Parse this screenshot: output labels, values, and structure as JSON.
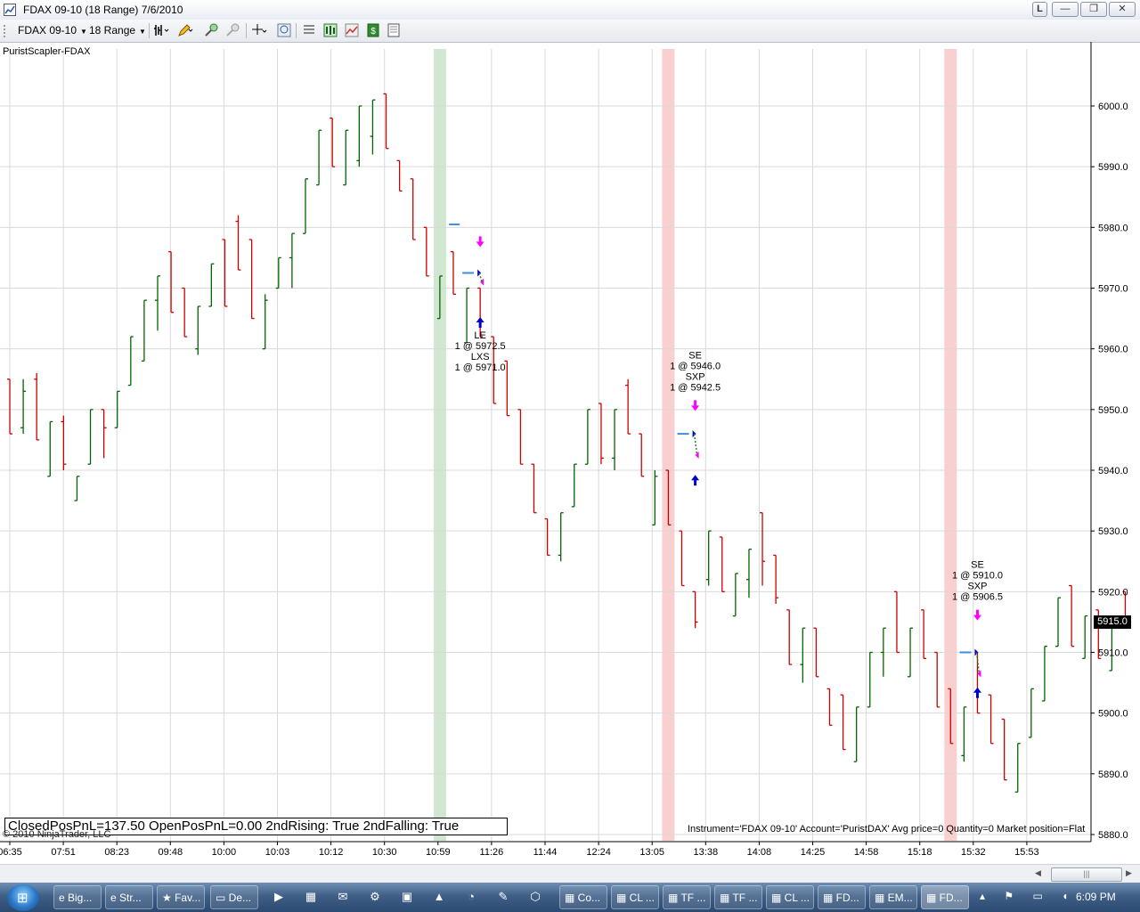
{
  "window": {
    "title": "FDAX 09-10 (18 Range)  7/6/2010",
    "buttons": {
      "link": "L",
      "minimize": "—",
      "maximize": "❐",
      "close": "✕"
    }
  },
  "toolbar": {
    "instrument": "FDAX 09-10",
    "period": "18 Range",
    "icons": [
      "bar-type-icon",
      "drawing-pencil-icon",
      "zoom-in-icon",
      "zoom-out-icon",
      "crosshair-icon",
      "magnify-icon",
      "properties-icon",
      "strategies-icon",
      "indicators-icon",
      "dollar-icon",
      "data-box-icon"
    ]
  },
  "chart": {
    "indicator_label": "PuristScapler-FDAX",
    "pnl_text": "ClosedPosPnL=137.50 OpenPosPnL=0.00 2ndRising: True 2ndFalling: True",
    "copyright": "© 2010 NinjaTrader, LLC",
    "account_info": "Instrument='FDAX 09-10' Account='PuristDAX' Avg price=0 Quantity=0 Market position=Flat",
    "last_price": "5915.0",
    "colors": {
      "up": "#006400",
      "down": "#cc0000",
      "grid": "#d9d9d9",
      "green_band": "#cfe8cf",
      "red_band": "#f9cfcf",
      "buy_arrow": "#0000cc",
      "sell_arrow": "#ff00ff"
    }
  },
  "chart_data": {
    "type": "bar",
    "title": "FDAX 09-10 (18 Range)",
    "y_ticks": [
      "6000.0",
      "5990.0",
      "5980.0",
      "5970.0",
      "5960.0",
      "5950.0",
      "5940.0",
      "5930.0",
      "5920.0",
      "5910.0",
      "5900.0",
      "5890.0",
      "5880.0"
    ],
    "ylim": [
      5880,
      6000
    ],
    "x_ticks": [
      "06:35",
      "07:51",
      "08:23",
      "09:48",
      "10:00",
      "10:03",
      "10:12",
      "10:30",
      "10:59",
      "11:26",
      "11:44",
      "12:24",
      "13:05",
      "13:38",
      "14:08",
      "14:25",
      "14:58",
      "15:18",
      "15:32",
      "15:53"
    ],
    "grid": true,
    "bars": [
      {
        "o": 5955,
        "c": 5946,
        "h": 5955,
        "l": 5946
      },
      {
        "o": 5947,
        "c": 5953,
        "h": 5955,
        "l": 5946
      },
      {
        "o": 5955,
        "c": 5945,
        "h": 5956,
        "l": 5945
      },
      {
        "o": 5939,
        "c": 5948,
        "h": 5948,
        "l": 5939
      },
      {
        "o": 5948,
        "c": 5941,
        "h": 5949,
        "l": 5940
      },
      {
        "o": 5935,
        "c": 5939,
        "h": 5939,
        "l": 5935
      },
      {
        "o": 5941,
        "c": 5950,
        "h": 5950,
        "l": 5941
      },
      {
        "o": 5950,
        "c": 5947,
        "h": 5950,
        "l": 5942
      },
      {
        "o": 5947,
        "c": 5953,
        "h": 5953,
        "l": 5947
      },
      {
        "o": 5954,
        "c": 5962,
        "h": 5962,
        "l": 5954
      },
      {
        "o": 5958,
        "c": 5968,
        "h": 5968,
        "l": 5958
      },
      {
        "o": 5968,
        "c": 5972,
        "h": 5972,
        "l": 5963
      },
      {
        "o": 5976,
        "c": 5966,
        "h": 5976,
        "l": 5966
      },
      {
        "o": 5970,
        "c": 5962,
        "h": 5970,
        "l": 5962
      },
      {
        "o": 5960,
        "c": 5967,
        "h": 5967,
        "l": 5959
      },
      {
        "o": 5967,
        "c": 5974,
        "h": 5974,
        "l": 5967
      },
      {
        "o": 5978,
        "c": 5967,
        "h": 5978,
        "l": 5967
      },
      {
        "o": 5981,
        "c": 5973,
        "h": 5982,
        "l": 5973
      },
      {
        "o": 5978,
        "c": 5965,
        "h": 5978,
        "l": 5965
      },
      {
        "o": 5960,
        "c": 5968,
        "h": 5969,
        "l": 5960
      },
      {
        "o": 5970,
        "c": 5975,
        "h": 5975,
        "l": 5970
      },
      {
        "o": 5975,
        "c": 5979,
        "h": 5979,
        "l": 5970
      },
      {
        "o": 5979,
        "c": 5988,
        "h": 5988,
        "l": 5979
      },
      {
        "o": 5987,
        "c": 5996,
        "h": 5996,
        "l": 5987
      },
      {
        "o": 5998,
        "c": 5990,
        "h": 5998,
        "l": 5990
      },
      {
        "o": 5987,
        "c": 5996,
        "h": 5996,
        "l": 5987
      },
      {
        "o": 5991,
        "c": 6000,
        "h": 6000,
        "l": 5990
      },
      {
        "o": 5995,
        "c": 6001,
        "h": 6001,
        "l": 5992
      },
      {
        "o": 6002,
        "c": 5993,
        "h": 6002,
        "l": 5993
      },
      {
        "o": 5991,
        "c": 5986,
        "h": 5991,
        "l": 5986
      },
      {
        "o": 5988,
        "c": 5978,
        "h": 5988,
        "l": 5978
      },
      {
        "o": 5980,
        "c": 5972,
        "h": 5980,
        "l": 5972
      },
      {
        "o": 5965,
        "c": 5972,
        "h": 5972,
        "l": 5965
      },
      {
        "o": 5976,
        "c": 5969,
        "h": 5976,
        "l": 5969
      },
      {
        "o": 5961,
        "c": 5970,
        "h": 5970,
        "l": 5961
      },
      {
        "o": 5970,
        "c": 5962,
        "h": 5970,
        "l": 5962
      },
      {
        "o": 5962,
        "c": 5951,
        "h": 5962,
        "l": 5951
      },
      {
        "o": 5958,
        "c": 5949,
        "h": 5958,
        "l": 5949
      },
      {
        "o": 5950,
        "c": 5941,
        "h": 5950,
        "l": 5941
      },
      {
        "o": 5941,
        "c": 5933,
        "h": 5941,
        "l": 5933
      },
      {
        "o": 5932,
        "c": 5926,
        "h": 5932,
        "l": 5926
      },
      {
        "o": 5926,
        "c": 5933,
        "h": 5933,
        "l": 5925
      },
      {
        "o": 5934,
        "c": 5941,
        "h": 5941,
        "l": 5934
      },
      {
        "o": 5941,
        "c": 5950,
        "h": 5950,
        "l": 5941
      },
      {
        "o": 5951,
        "c": 5942,
        "h": 5951,
        "l": 5941
      },
      {
        "o": 5942,
        "c": 5950,
        "h": 5950,
        "l": 5940
      },
      {
        "o": 5954,
        "c": 5946,
        "h": 5955,
        "l": 5946
      },
      {
        "o": 5946,
        "c": 5939,
        "h": 5946,
        "l": 5939
      },
      {
        "o": 5931,
        "c": 5939,
        "h": 5940,
        "l": 5931
      },
      {
        "o": 5940,
        "c": 5931,
        "h": 5940,
        "l": 5931
      },
      {
        "o": 5930,
        "c": 5921,
        "h": 5930,
        "l": 5921
      },
      {
        "o": 5920,
        "c": 5915,
        "h": 5920,
        "l": 5914
      },
      {
        "o": 5922,
        "c": 5930,
        "h": 5930,
        "l": 5921
      },
      {
        "o": 5929,
        "c": 5920,
        "h": 5929,
        "l": 5920
      },
      {
        "o": 5916,
        "c": 5923,
        "h": 5923,
        "l": 5916
      },
      {
        "o": 5922,
        "c": 5927,
        "h": 5927,
        "l": 5919
      },
      {
        "o": 5933,
        "c": 5925,
        "h": 5933,
        "l": 5921
      },
      {
        "o": 5926,
        "c": 5919,
        "h": 5926,
        "l": 5918
      },
      {
        "o": 5917,
        "c": 5908,
        "h": 5917,
        "l": 5908
      },
      {
        "o": 5908,
        "c": 5914,
        "h": 5914,
        "l": 5905
      },
      {
        "o": 5914,
        "c": 5906,
        "h": 5914,
        "l": 5906
      },
      {
        "o": 5904,
        "c": 5898,
        "h": 5904,
        "l": 5898
      },
      {
        "o": 5903,
        "c": 5894,
        "h": 5903,
        "l": 5894
      },
      {
        "o": 5892,
        "c": 5901,
        "h": 5901,
        "l": 5892
      },
      {
        "o": 5901,
        "c": 5910,
        "h": 5910,
        "l": 5901
      },
      {
        "o": 5910,
        "c": 5914,
        "h": 5914,
        "l": 5906
      },
      {
        "o": 5920,
        "c": 5910,
        "h": 5920,
        "l": 5910
      },
      {
        "o": 5906,
        "c": 5914,
        "h": 5914,
        "l": 5906
      },
      {
        "o": 5917,
        "c": 5909,
        "h": 5917,
        "l": 5909
      },
      {
        "o": 5910,
        "c": 5901,
        "h": 5910,
        "l": 5901
      },
      {
        "o": 5904,
        "c": 5895,
        "h": 5904,
        "l": 5895
      },
      {
        "o": 5893,
        "c": 5901,
        "h": 5901,
        "l": 5892
      },
      {
        "o": 5910,
        "c": 5900,
        "h": 5910,
        "l": 5900
      },
      {
        "o": 5903,
        "c": 5895,
        "h": 5903,
        "l": 5895
      },
      {
        "o": 5899,
        "c": 5889,
        "h": 5899,
        "l": 5889
      },
      {
        "o": 5887,
        "c": 5895,
        "h": 5895,
        "l": 5887
      },
      {
        "o": 5896,
        "c": 5904,
        "h": 5904,
        "l": 5896
      },
      {
        "o": 5902,
        "c": 5911,
        "h": 5911,
        "l": 5902
      },
      {
        "o": 5911,
        "c": 5919,
        "h": 5919,
        "l": 5911
      },
      {
        "o": 5921,
        "c": 5911,
        "h": 5921,
        "l": 5911
      },
      {
        "o": 5909,
        "c": 5916,
        "h": 5916,
        "l": 5909
      },
      {
        "o": 5917,
        "c": 5909,
        "h": 5917,
        "l": 5909
      },
      {
        "o": 5907,
        "c": 5915,
        "h": 5915,
        "l": 5907
      },
      {
        "o": 5920,
        "c": 5915,
        "h": 5920,
        "l": 5914
      }
    ],
    "highlight_bands": [
      {
        "bar": 32,
        "color": "green"
      },
      {
        "bar": 49,
        "color": "red"
      },
      {
        "bar": 70,
        "color": "red"
      }
    ],
    "trades": [
      {
        "bar": 35,
        "lines": [
          "LE",
          "1 @ 5972.5",
          "LXS",
          "1 @ 5971.0"
        ],
        "label_pos": "below",
        "entry_price": 5972.5,
        "exit_price": 5971.0,
        "stop_price": 5980.5,
        "arrow_up_price": 5964.5,
        "arrow_down_price": 5977.5
      },
      {
        "bar": 51,
        "lines": [
          "SE",
          "1 @ 5946.0",
          "SXP",
          "1 @ 5942.5"
        ],
        "label_pos": "above",
        "entry_price": 5946.0,
        "exit_price": 5942.5,
        "arrow_up_price": 5938.5,
        "arrow_down_price": 5950.5
      },
      {
        "bar": 72,
        "lines": [
          "SE",
          "1 @ 5910.0",
          "SXP",
          "1 @ 5906.5"
        ],
        "label_pos": "above",
        "entry_price": 5910.0,
        "exit_price": 5906.5,
        "arrow_up_price": 5903.5,
        "arrow_down_price": 5916.0
      }
    ]
  },
  "taskbar": {
    "start_glyph": "⊞",
    "quick_launch_glyphs": [
      "e",
      "e",
      "★",
      "▭"
    ],
    "tasks": [
      "Big...",
      "Str...",
      "Fav...",
      "De...",
      "Co...",
      "CL ...",
      "TF ...",
      "TF ...",
      "CL ...",
      "FD...",
      "EM...",
      "FD..."
    ],
    "pinned_glyphs": [
      "▶",
      "▦",
      "✉",
      "⚙",
      "▣",
      "▲",
      "◔",
      "✎",
      "⬡"
    ],
    "tray": "▴ ⚑ ▭ ◖",
    "clock": "6:09 PM"
  }
}
